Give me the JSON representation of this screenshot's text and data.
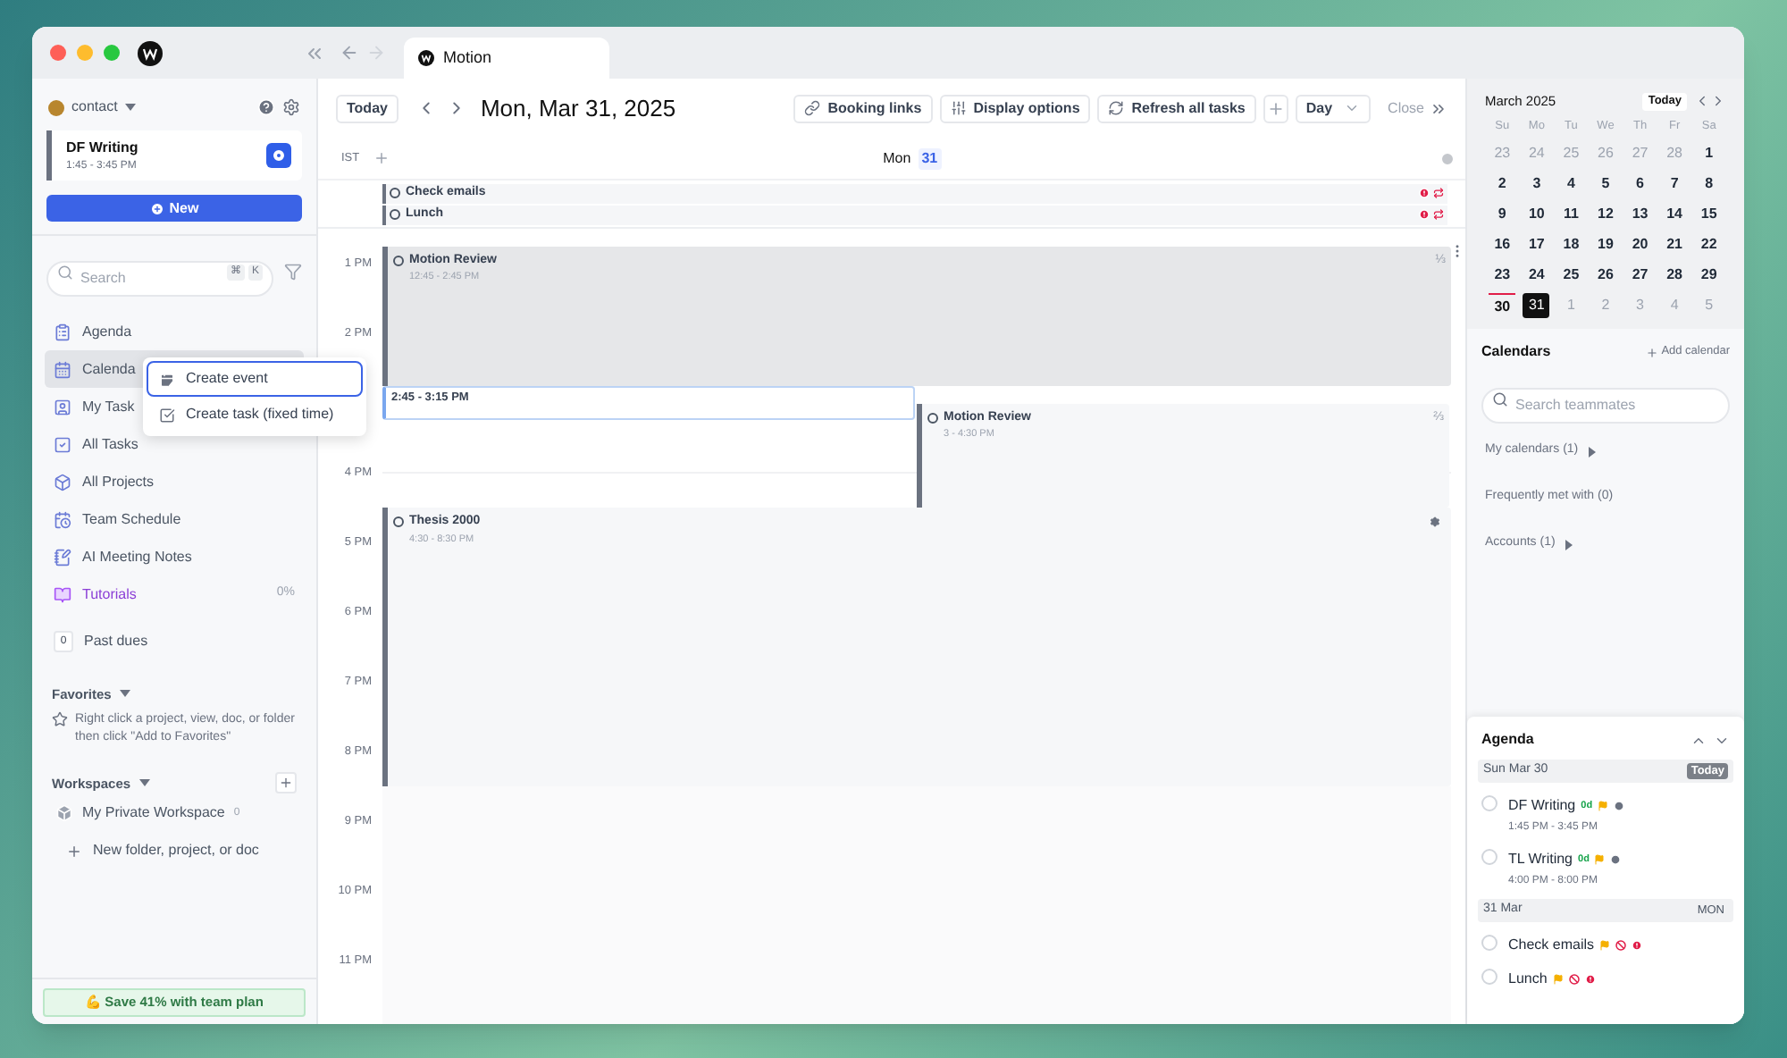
{
  "window": {
    "tab_title": "Motion"
  },
  "sidebar": {
    "account": "contact",
    "current_task": {
      "title": "DF Writing",
      "time": "1:45 - 3:45 PM"
    },
    "new_button": "New",
    "search": {
      "placeholder": "Search",
      "keys": [
        "⌘",
        "K"
      ]
    },
    "nav_items": [
      {
        "label": "Agenda",
        "selected": false,
        "kind": "nav"
      },
      {
        "label": "Calenda",
        "selected": true,
        "kind": "nav"
      },
      {
        "label": "My Task",
        "selected": false,
        "kind": "nav"
      },
      {
        "label": "All Tasks",
        "selected": false,
        "kind": "nav"
      },
      {
        "label": "All Projects",
        "selected": false,
        "kind": "nav"
      },
      {
        "label": "Team Schedule",
        "selected": false,
        "kind": "nav"
      },
      {
        "label": "AI Meeting Notes",
        "selected": false,
        "kind": "nav"
      },
      {
        "label": "Tutorials",
        "selected": false,
        "kind": "tutorial",
        "progress": "0%"
      }
    ],
    "past_dues": {
      "count": "0",
      "label": "Past dues"
    },
    "favorites": {
      "title": "Favorites",
      "hint": "Right click a project, view, doc, or folder then click \"Add to Favorites\""
    },
    "workspaces": {
      "title": "Workspaces",
      "items": [
        {
          "label": "My Private Workspace",
          "count": "0"
        }
      ],
      "new_item": "New folder, project, or doc"
    },
    "upgrade": "💪 Save 41% with team plan"
  },
  "context_menu": [
    {
      "label": "Create event",
      "selected": true
    },
    {
      "label": "Create task (fixed time)",
      "selected": false
    }
  ],
  "toolbar": {
    "today": "Today",
    "date": "Mon, Mar 31, 2025",
    "buttons": [
      "Booking links",
      "Display options",
      "Refresh all tasks"
    ],
    "view": "Day",
    "close": "Close"
  },
  "day_header": {
    "timezone": "IST",
    "weekday": "Mon",
    "day": "31"
  },
  "all_day": [
    {
      "title": "Check emails",
      "overdue": true,
      "recurring": true
    },
    {
      "title": "Lunch",
      "overdue": true,
      "recurring": true
    }
  ],
  "hours": [
    "1 PM",
    "2 PM",
    "4 PM",
    "5 PM",
    "6 PM",
    "7 PM",
    "8 PM",
    "9 PM",
    "10 PM",
    "11 PM"
  ],
  "events": [
    {
      "kind": "event",
      "title": "Motion Review",
      "time": "12:45 - 2:45 PM",
      "fraction": "⅓"
    },
    {
      "kind": "draft",
      "time": "2:45 - 3:15 PM"
    },
    {
      "kind": "event",
      "title": "Motion Review",
      "time": "3 - 4:30 PM",
      "fraction": "⅔"
    },
    {
      "kind": "task",
      "title": "Thesis 2000",
      "time": "4:30 - 8:30 PM"
    }
  ],
  "mini_calendar": {
    "month": "March 2025",
    "today_button": "Today",
    "weekdays": [
      "Su",
      "Mo",
      "Tu",
      "We",
      "Th",
      "Fr",
      "Sa"
    ],
    "weeks": [
      [
        {
          "day": "23",
          "kind": "other"
        },
        {
          "day": "24",
          "kind": "other"
        },
        {
          "day": "25",
          "kind": "other"
        },
        {
          "day": "26",
          "kind": "other"
        },
        {
          "day": "27",
          "kind": "other"
        },
        {
          "day": "28",
          "kind": "other"
        },
        {
          "day": "1",
          "kind": "current"
        }
      ],
      [
        {
          "day": "2",
          "kind": "current"
        },
        {
          "day": "3",
          "kind": "current"
        },
        {
          "day": "4",
          "kind": "current"
        },
        {
          "day": "5",
          "kind": "current"
        },
        {
          "day": "6",
          "kind": "current"
        },
        {
          "day": "7",
          "kind": "current"
        },
        {
          "day": "8",
          "kind": "current"
        }
      ],
      [
        {
          "day": "9",
          "kind": "current"
        },
        {
          "day": "10",
          "kind": "current"
        },
        {
          "day": "11",
          "kind": "current"
        },
        {
          "day": "12",
          "kind": "current"
        },
        {
          "day": "13",
          "kind": "current"
        },
        {
          "day": "14",
          "kind": "current"
        },
        {
          "day": "15",
          "kind": "current"
        }
      ],
      [
        {
          "day": "16",
          "kind": "current"
        },
        {
          "day": "17",
          "kind": "current"
        },
        {
          "day": "18",
          "kind": "current"
        },
        {
          "day": "19",
          "kind": "current"
        },
        {
          "day": "20",
          "kind": "current"
        },
        {
          "day": "21",
          "kind": "current"
        },
        {
          "day": "22",
          "kind": "current"
        }
      ],
      [
        {
          "day": "23",
          "kind": "current"
        },
        {
          "day": "24",
          "kind": "current"
        },
        {
          "day": "25",
          "kind": "current"
        },
        {
          "day": "26",
          "kind": "current"
        },
        {
          "day": "27",
          "kind": "current"
        },
        {
          "day": "28",
          "kind": "current"
        },
        {
          "day": "29",
          "kind": "current"
        }
      ],
      [
        {
          "day": "30",
          "kind": "today"
        },
        {
          "day": "31",
          "kind": "selected"
        },
        {
          "day": "1",
          "kind": "other"
        },
        {
          "day": "2",
          "kind": "other"
        },
        {
          "day": "3",
          "kind": "other"
        },
        {
          "day": "4",
          "kind": "other"
        },
        {
          "day": "5",
          "kind": "other"
        }
      ]
    ]
  },
  "calendars": {
    "title": "Calendars",
    "add": "Add calendar",
    "search_placeholder": "Search teammates",
    "sections": [
      {
        "label": "My calendars (1)",
        "expandable": true
      },
      {
        "label": "Frequently met with (0)",
        "expandable": false
      },
      {
        "label": "Accounts (1)",
        "expandable": true
      }
    ]
  },
  "agenda": {
    "title": "Agenda",
    "groups": [
      {
        "date": "Sun Mar 30",
        "badge": "Today",
        "is_today": true,
        "items": [
          {
            "title": "DF Writing",
            "checked": false,
            "due": "0d",
            "flagged": true,
            "scheduled": true,
            "blocked": false,
            "overdue": false,
            "time": "1:45 PM - 3:45 PM"
          },
          {
            "title": "TL Writing",
            "checked": false,
            "due": "0d",
            "flagged": true,
            "scheduled": true,
            "blocked": false,
            "overdue": false,
            "time": "4:00 PM - 8:00 PM"
          }
        ]
      },
      {
        "date": "31 Mar",
        "badge": "MON",
        "is_today": false,
        "items": [
          {
            "title": "Check emails",
            "checked": false,
            "flagged": true,
            "scheduled": false,
            "blocked": true,
            "overdue": true
          },
          {
            "title": "Lunch",
            "checked": false,
            "flagged": true,
            "scheduled": false,
            "blocked": true,
            "overdue": true
          }
        ]
      }
    ]
  }
}
